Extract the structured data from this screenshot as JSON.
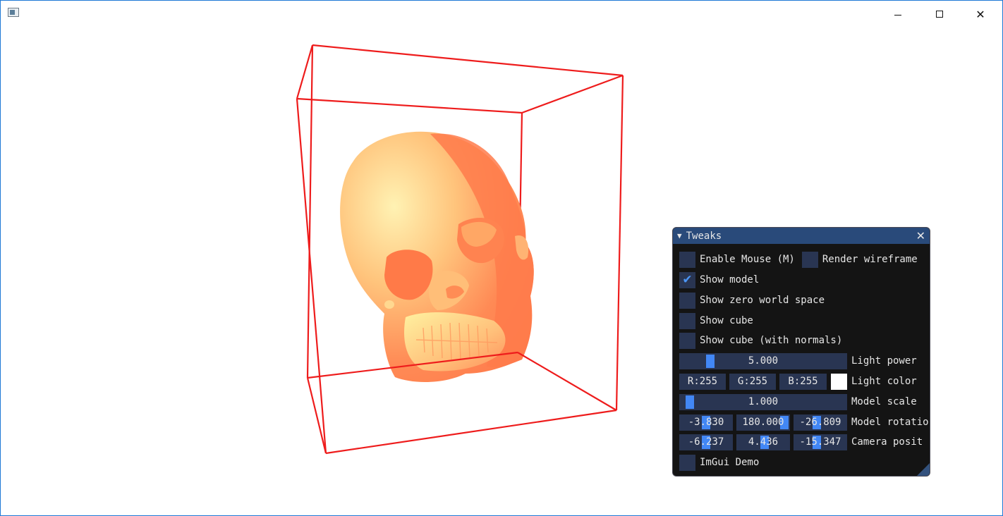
{
  "titlebar": {
    "minimize_label": "",
    "maximize_label": "",
    "close_label": "✕"
  },
  "scene": {
    "box_color": "#ee1c1c",
    "model_colors": [
      "#fff3a6",
      "#ff9b5c",
      "#ff7b4d"
    ]
  },
  "panel": {
    "title": "Tweaks",
    "collapse_icon": "▼",
    "close_icon": "✕",
    "checkboxes": {
      "enable_mouse": {
        "label": "Enable Mouse (M)",
        "checked": false
      },
      "render_wireframe": {
        "label": "Render wireframe",
        "checked": false
      },
      "show_model": {
        "label": "Show model",
        "checked": true
      },
      "show_zero_world_space": {
        "label": "Show zero world space",
        "checked": false
      },
      "show_cube": {
        "label": "Show cube",
        "checked": false
      },
      "show_cube_normals": {
        "label": "Show cube (with normals)",
        "checked": false
      },
      "imgui_demo": {
        "label": "ImGui Demo",
        "checked": false
      }
    },
    "check_glyph": "✔",
    "light_power": {
      "value": "5.000",
      "label": "Light power"
    },
    "light_color": {
      "r": "R:255",
      "g": "G:255",
      "b": "B:255",
      "label": "Light color",
      "swatch": "#ffffff"
    },
    "model_scale": {
      "value": "1.000",
      "label": "Model scale"
    },
    "model_rotation": {
      "x": "-3.830",
      "y": "180.000",
      "z": "-26.809",
      "label": "Model rotatio"
    },
    "camera_position": {
      "x": "-6.237",
      "y": "4.436",
      "z": "-15.347",
      "label": "Camera posit"
    }
  }
}
